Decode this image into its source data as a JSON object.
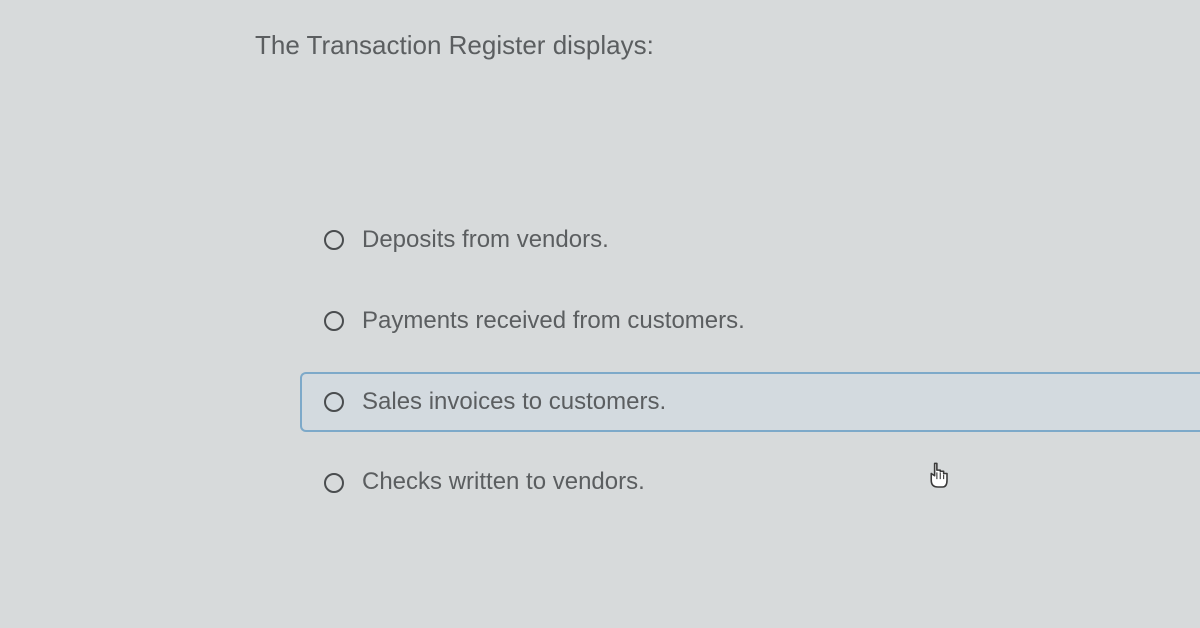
{
  "question": {
    "prompt": "The Transaction Register displays:"
  },
  "options": [
    {
      "label": "Deposits from vendors.",
      "highlighted": false
    },
    {
      "label": "Payments received from customers.",
      "highlighted": false
    },
    {
      "label": "Sales invoices to customers.",
      "highlighted": true
    },
    {
      "label": "Checks written to vendors.",
      "highlighted": false
    }
  ]
}
